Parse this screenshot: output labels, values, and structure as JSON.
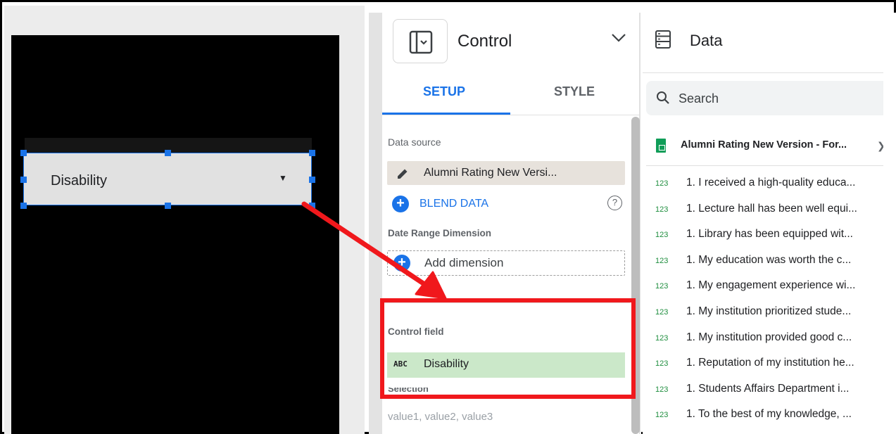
{
  "canvas": {
    "control_value": "Disability"
  },
  "properties_panel": {
    "component_title": "Control",
    "tabs": [
      {
        "label": "SETUP",
        "active": true
      },
      {
        "label": "STYLE",
        "active": false
      }
    ],
    "data_source_label": "Data source",
    "data_source_value": "Alumni Rating New Versi...",
    "blend_data_label": "BLEND DATA",
    "help_icon": "?",
    "date_range_label": "Date Range Dimension",
    "add_dimension_label": "Add dimension",
    "control_field_label": "Control field",
    "control_field_type": "ABC",
    "control_field_value": "Disability",
    "selection_label_partial": "Selection",
    "values_placeholder": "value1, value2, value3"
  },
  "data_panel": {
    "title": "Data",
    "search_placeholder": "Search",
    "source_name": "Alumni Rating New Version - For...",
    "fields": [
      {
        "type": "123",
        "name": "1. I received a high-quality educa..."
      },
      {
        "type": "123",
        "name": "1. Lecture hall has been well equi..."
      },
      {
        "type": "123",
        "name": "1. Library has been equipped wit..."
      },
      {
        "type": "123",
        "name": "1. My education was worth the c..."
      },
      {
        "type": "123",
        "name": "1. My engagement experience wi..."
      },
      {
        "type": "123",
        "name": "1. My institution prioritized stude..."
      },
      {
        "type": "123",
        "name": "1. My institution provided good c..."
      },
      {
        "type": "123",
        "name": "1. Reputation of my institution he..."
      },
      {
        "type": "123",
        "name": "1. Students Affairs Department i..."
      },
      {
        "type": "123",
        "name": "1. To the best of my knowledge, ..."
      }
    ]
  },
  "colors": {
    "accent": "#1a73e8",
    "highlight_red": "#f0181c",
    "field_green": "#cbe8c9",
    "type_green": "#1e8e3e"
  }
}
